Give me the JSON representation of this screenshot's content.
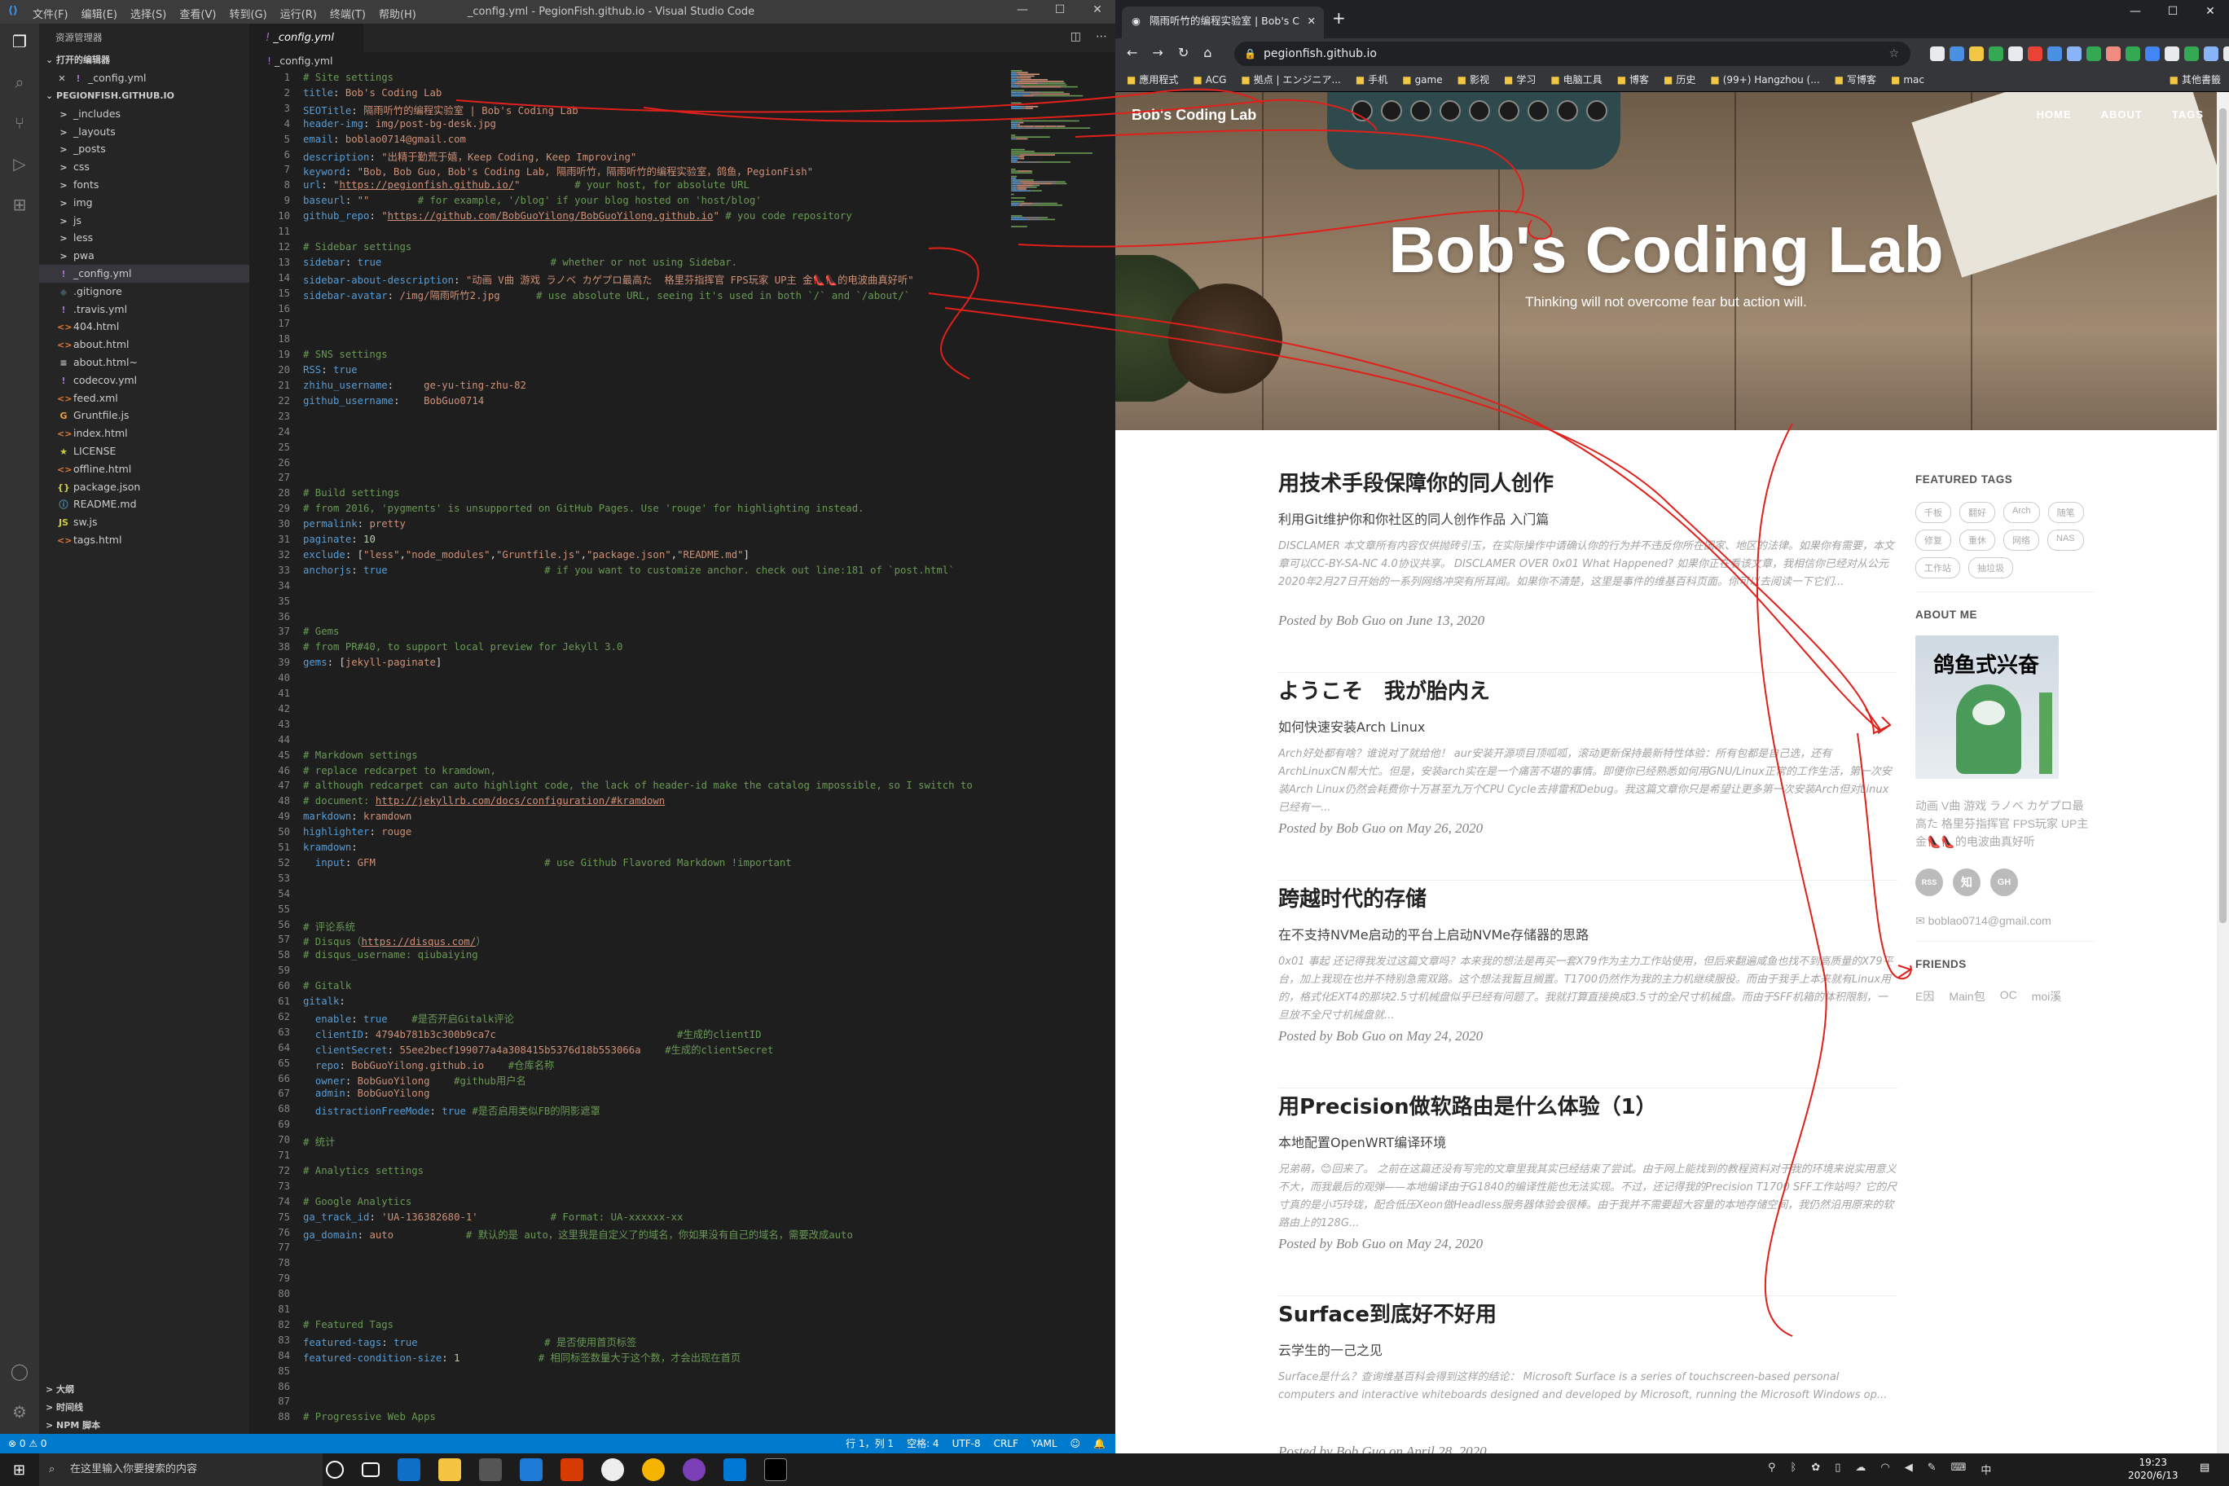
{
  "vscode": {
    "window_title": "_config.yml - PegionFish.github.io - Visual Studio Code",
    "menu": [
      "文件(F)",
      "编辑(E)",
      "选择(S)",
      "查看(V)",
      "转到(G)",
      "运行(R)",
      "终端(T)",
      "帮助(H)"
    ],
    "explorer_title": "资源管理器",
    "open_editors_label": "打开的编辑器",
    "open_editor_file": "_config.yml",
    "folder_label": "PEGIONFISH.GITHUB.IO",
    "files": [
      {
        "name": "_includes",
        "icon": ">",
        "color": "#cccccc"
      },
      {
        "name": "_layouts",
        "icon": ">",
        "color": "#cccccc"
      },
      {
        "name": "_posts",
        "icon": ">",
        "color": "#cccccc"
      },
      {
        "name": "css",
        "icon": ">",
        "color": "#cccccc"
      },
      {
        "name": "fonts",
        "icon": ">",
        "color": "#cccccc"
      },
      {
        "name": "img",
        "icon": ">",
        "color": "#cccccc"
      },
      {
        "name": "js",
        "icon": ">",
        "color": "#cccccc"
      },
      {
        "name": "less",
        "icon": ">",
        "color": "#cccccc"
      },
      {
        "name": "pwa",
        "icon": ">",
        "color": "#cccccc"
      },
      {
        "name": "_config.yml",
        "icon": "!",
        "color": "#a074c4",
        "selected": true
      },
      {
        "name": ".gitignore",
        "icon": "◆",
        "color": "#41535b"
      },
      {
        "name": ".travis.yml",
        "icon": "!",
        "color": "#a074c4"
      },
      {
        "name": "404.html",
        "icon": "<>",
        "color": "#e37933"
      },
      {
        "name": "about.html",
        "icon": "<>",
        "color": "#e37933"
      },
      {
        "name": "about.html~",
        "icon": "≡",
        "color": "#cccccc"
      },
      {
        "name": "codecov.yml",
        "icon": "!",
        "color": "#a074c4"
      },
      {
        "name": "feed.xml",
        "icon": "<>",
        "color": "#e37933"
      },
      {
        "name": "Gruntfile.js",
        "icon": "G",
        "color": "#e8a23c"
      },
      {
        "name": "index.html",
        "icon": "<>",
        "color": "#e37933"
      },
      {
        "name": "LICENSE",
        "icon": "★",
        "color": "#cbcb41"
      },
      {
        "name": "offline.html",
        "icon": "<>",
        "color": "#e37933"
      },
      {
        "name": "package.json",
        "icon": "{}",
        "color": "#cbcb41"
      },
      {
        "name": "README.md",
        "icon": "ⓘ",
        "color": "#519aba"
      },
      {
        "name": "sw.js",
        "icon": "JS",
        "color": "#cbcb41"
      },
      {
        "name": "tags.html",
        "icon": "<>",
        "color": "#e37933"
      }
    ],
    "bottom_sections": [
      "大纲",
      "时间线",
      "NPM 脚本"
    ],
    "tab_label": "_config.yml",
    "breadcrumb": "_config.yml",
    "code_lines": [
      [
        [
          "c",
          "# Site settings"
        ]
      ],
      [
        [
          "k",
          "title"
        ],
        [
          "p",
          ": "
        ],
        [
          "s",
          "Bob's Coding Lab"
        ]
      ],
      [
        [
          "k",
          "SEOTitle"
        ],
        [
          "p",
          ": "
        ],
        [
          "s",
          "隔雨听竹的编程实验室 | Bob's Coding Lab"
        ]
      ],
      [
        [
          "k",
          "header-img"
        ],
        [
          "p",
          ": "
        ],
        [
          "s",
          "img/post-bg-desk.jpg"
        ]
      ],
      [
        [
          "k",
          "email"
        ],
        [
          "p",
          ": "
        ],
        [
          "s",
          "boblao0714@gmail.com"
        ]
      ],
      [
        [
          "k",
          "description"
        ],
        [
          "p",
          ": "
        ],
        [
          "s",
          "\"出精于勤荒于嬉，Keep Coding, Keep Improving\""
        ]
      ],
      [
        [
          "k",
          "keyword"
        ],
        [
          "p",
          ": "
        ],
        [
          "s",
          "\"Bob, Bob Guo, Bob's Coding Lab, 隔雨听竹，隔雨听竹的编程实验室，鸽鱼，PegionFish\""
        ]
      ],
      [
        [
          "k",
          "url"
        ],
        [
          "p",
          ": "
        ],
        [
          "s",
          "\""
        ],
        [
          "l",
          "https://pegionfish.github.io/"
        ],
        [
          "s",
          "\""
        ],
        [
          "p",
          "         "
        ],
        [
          "c",
          "# your host, for absolute URL"
        ]
      ],
      [
        [
          "k",
          "baseurl"
        ],
        [
          "p",
          ": "
        ],
        [
          "s",
          "\"\""
        ],
        [
          "p",
          "        "
        ],
        [
          "c",
          "# for example, '/blog' if your blog hosted on 'host/blog'"
        ]
      ],
      [
        [
          "k",
          "github_repo"
        ],
        [
          "p",
          ": "
        ],
        [
          "s",
          "\""
        ],
        [
          "l",
          "https://github.com/BobGuoYilong/BobGuoYilong.github.io"
        ],
        [
          "s",
          "\""
        ],
        [
          "p",
          " "
        ],
        [
          "c",
          "# you code repository"
        ]
      ],
      [],
      [
        [
          "c",
          "# Sidebar settings"
        ]
      ],
      [
        [
          "k",
          "sidebar"
        ],
        [
          "p",
          ": "
        ],
        [
          "k",
          "true"
        ],
        [
          "p",
          "                            "
        ],
        [
          "c",
          "# whether or not using Sidebar."
        ]
      ],
      [
        [
          "k",
          "sidebar-about-description"
        ],
        [
          "p",
          ": "
        ],
        [
          "s",
          "\"动画 V曲 游戏 ラノベ カゲプロ最高た  格里芬指挥官 FPS玩家 UP主 金👠👠的电波曲真好听\""
        ]
      ],
      [
        [
          "k",
          "sidebar-avatar"
        ],
        [
          "p",
          ": "
        ],
        [
          "s",
          "/img/隔雨听竹2.jpg"
        ],
        [
          "p",
          "      "
        ],
        [
          "c",
          "# use absolute URL, seeing it's used in both `/` and `/about/`"
        ]
      ],
      [],
      [],
      [],
      [
        [
          "c",
          "# SNS settings"
        ]
      ],
      [
        [
          "k",
          "RSS"
        ],
        [
          "p",
          ": "
        ],
        [
          "k",
          "true"
        ]
      ],
      [
        [
          "k",
          "zhihu_username"
        ],
        [
          "p",
          ":     "
        ],
        [
          "s",
          "ge-yu-ting-zhu-82"
        ]
      ],
      [
        [
          "k",
          "github_username"
        ],
        [
          "p",
          ":    "
        ],
        [
          "s",
          "BobGuo0714"
        ]
      ],
      [],
      [],
      [],
      [],
      [],
      [
        [
          "c",
          "# Build settings"
        ]
      ],
      [
        [
          "c",
          "# from 2016, 'pygments' is unsupported on GitHub Pages. Use 'rouge' for highlighting instead."
        ]
      ],
      [
        [
          "k",
          "permalink"
        ],
        [
          "p",
          ": "
        ],
        [
          "s",
          "pretty"
        ]
      ],
      [
        [
          "k",
          "paginate"
        ],
        [
          "p",
          ": "
        ],
        [
          "n",
          "10"
        ]
      ],
      [
        [
          "k",
          "exclude"
        ],
        [
          "p",
          ": ["
        ],
        [
          "s",
          "\"less\""
        ],
        [
          "p",
          ","
        ],
        [
          "s",
          "\"node_modules\""
        ],
        [
          "p",
          ","
        ],
        [
          "s",
          "\"Gruntfile.js\""
        ],
        [
          "p",
          ","
        ],
        [
          "s",
          "\"package.json\""
        ],
        [
          "p",
          ","
        ],
        [
          "s",
          "\"README.md\""
        ],
        [
          "p",
          "]"
        ]
      ],
      [
        [
          "k",
          "anchorjs"
        ],
        [
          "p",
          ": "
        ],
        [
          "k",
          "true"
        ],
        [
          "p",
          "                          "
        ],
        [
          "c",
          "# if you want to customize anchor. check out line:181 of `post.html`"
        ]
      ],
      [],
      [],
      [],
      [
        [
          "c",
          "# Gems"
        ]
      ],
      [
        [
          "c",
          "# from PR#40, to support local preview for Jekyll 3.0"
        ]
      ],
      [
        [
          "k",
          "gems"
        ],
        [
          "p",
          ": ["
        ],
        [
          "s",
          "jekyll-paginate"
        ],
        [
          "p",
          "]"
        ]
      ],
      [],
      [],
      [],
      [],
      [],
      [
        [
          "c",
          "# Markdown settings"
        ]
      ],
      [
        [
          "c",
          "# replace redcarpet to kramdown,"
        ]
      ],
      [
        [
          "c",
          "# although redcarpet can auto highlight code, the lack of header-id make the catalog impossible, so I switch to"
        ]
      ],
      [
        [
          "c",
          "# document: "
        ],
        [
          "l",
          "http://jekyllrb.com/docs/configuration/#kramdown"
        ]
      ],
      [
        [
          "k",
          "markdown"
        ],
        [
          "p",
          ": "
        ],
        [
          "s",
          "kramdown"
        ]
      ],
      [
        [
          "k",
          "highlighter"
        ],
        [
          "p",
          ": "
        ],
        [
          "s",
          "rouge"
        ]
      ],
      [
        [
          "k",
          "kramdown"
        ],
        [
          "p",
          ":"
        ]
      ],
      [
        [
          "p",
          "  "
        ],
        [
          "k",
          "input"
        ],
        [
          "p",
          ": "
        ],
        [
          "s",
          "GFM"
        ],
        [
          "p",
          "                            "
        ],
        [
          "c",
          "# use Github Flavored Markdown !important"
        ]
      ],
      [],
      [],
      [],
      [
        [
          "c",
          "# 评论系统"
        ]
      ],
      [
        [
          "c",
          "# Disqus（"
        ],
        [
          "l",
          "https://disqus.com/"
        ],
        [
          "c",
          "）"
        ]
      ],
      [
        [
          "c",
          "# disqus_username: qiubaiying"
        ]
      ],
      [],
      [
        [
          "c",
          "# Gitalk"
        ]
      ],
      [
        [
          "k",
          "gitalk"
        ],
        [
          "p",
          ":"
        ]
      ],
      [
        [
          "p",
          "  "
        ],
        [
          "k",
          "enable"
        ],
        [
          "p",
          ": "
        ],
        [
          "k",
          "true"
        ],
        [
          "p",
          "    "
        ],
        [
          "c",
          "#是否开启Gitalk评论"
        ]
      ],
      [
        [
          "p",
          "  "
        ],
        [
          "k",
          "clientID"
        ],
        [
          "p",
          ": "
        ],
        [
          "s",
          "4794b781b3c300b9ca7c"
        ],
        [
          "p",
          "                              "
        ],
        [
          "c",
          "#生成的clientID"
        ]
      ],
      [
        [
          "p",
          "  "
        ],
        [
          "k",
          "clientSecret"
        ],
        [
          "p",
          ": "
        ],
        [
          "s",
          "55ee2becf199077a4a308415b5376d18b553066a"
        ],
        [
          "p",
          "    "
        ],
        [
          "c",
          "#生成的clientSecret"
        ]
      ],
      [
        [
          "p",
          "  "
        ],
        [
          "k",
          "repo"
        ],
        [
          "p",
          ": "
        ],
        [
          "s",
          "BobGuoYilong.github.io"
        ],
        [
          "p",
          "    "
        ],
        [
          "c",
          "#仓库名称"
        ]
      ],
      [
        [
          "p",
          "  "
        ],
        [
          "k",
          "owner"
        ],
        [
          "p",
          ": "
        ],
        [
          "s",
          "BobGuoYilong"
        ],
        [
          "p",
          "    "
        ],
        [
          "c",
          "#github用户名"
        ]
      ],
      [
        [
          "p",
          "  "
        ],
        [
          "k",
          "admin"
        ],
        [
          "p",
          ": "
        ],
        [
          "s",
          "BobGuoYilong"
        ]
      ],
      [
        [
          "p",
          "  "
        ],
        [
          "k",
          "distractionFreeMode"
        ],
        [
          "p",
          ": "
        ],
        [
          "k",
          "true"
        ],
        [
          "p",
          " "
        ],
        [
          "c",
          "#是否启用类似FB的阴影遮罩"
        ]
      ],
      [],
      [
        [
          "c",
          "# 统计"
        ]
      ],
      [],
      [
        [
          "c",
          "# Analytics settings"
        ]
      ],
      [],
      [
        [
          "c",
          "# Google Analytics"
        ]
      ],
      [
        [
          "k",
          "ga_track_id"
        ],
        [
          "p",
          ": "
        ],
        [
          "s",
          "'UA-136382680-1'"
        ],
        [
          "p",
          "            "
        ],
        [
          "c",
          "# Format: UA-xxxxxx-xx"
        ]
      ],
      [
        [
          "k",
          "ga_domain"
        ],
        [
          "p",
          ": "
        ],
        [
          "s",
          "auto"
        ],
        [
          "p",
          "            "
        ],
        [
          "c",
          "# 默认的是 auto，这里我是自定义了的域名，你如果没有自己的域名，需要改成auto"
        ]
      ],
      [],
      [],
      [],
      [],
      [],
      [
        [
          "c",
          "# Featured Tags"
        ]
      ],
      [
        [
          "k",
          "featured-tags"
        ],
        [
          "p",
          ": "
        ],
        [
          "k",
          "true"
        ],
        [
          "p",
          "                     "
        ],
        [
          "c",
          "# 是否使用首页标签"
        ]
      ],
      [
        [
          "k",
          "featured-condition-size"
        ],
        [
          "p",
          ": "
        ],
        [
          "n",
          "1"
        ],
        [
          "p",
          "             "
        ],
        [
          "c",
          "# 相同标签数量大于这个数，才会出现在首页"
        ]
      ],
      [],
      [],
      [],
      [
        [
          "c",
          "# Progressive Web Apps"
        ]
      ]
    ],
    "status": {
      "left": "⊗ 0 ⚠ 0",
      "position": "行 1，列 1",
      "spaces": "空格: 4",
      "encoding": "UTF-8",
      "eol": "CRLF",
      "language": "YAML"
    }
  },
  "chrome": {
    "tab_title": "隔雨听竹的编程实验室 | Bob's C",
    "url": "pegionfish.github.io",
    "bookmarks": [
      "應用程式",
      "ACG",
      "拠点 | エンジニア...",
      "手机",
      "game",
      "影视",
      "学习",
      "电脑工具",
      "博客",
      "历史",
      "(99+) Hangzhou (...",
      "写博客",
      "mac"
    ],
    "bookmark_other": "其他書籤",
    "site": {
      "brand": "Bob's Coding Lab",
      "nav": [
        "HOME",
        "ABOUT",
        "TAGS"
      ],
      "hero_title": "Bob's Coding Lab",
      "hero_subtitle": "Thinking will not overcome fear but action will.",
      "posts": [
        {
          "title": "用技术手段保障你的同人创作",
          "subtitle": "利用Git维护你和你社区的同人创作作品 入门篇",
          "excerpt": "DISCLAMER 本文章所有内容仅供抛砖引玉，在实际操作中请确认你的行为并不违反你所在国家、地区的法律。如果你有需要，本文章可以CC-BY-SA-NC 4.0协议共享。 DISCLAMER OVER 0x01 What Happened? 如果你正在看该文章，我相信你已经对从公元2020年2月27日开始的一系列网络冲突有所耳闻。如果你不清楚，这里是事件的维基百科页面。你可以去阅读一下它们...",
          "meta": "Posted by Bob Guo on June 13, 2020"
        },
        {
          "title": "ようこそ　我が胎内え",
          "subtitle": "如何快速安装Arch Linux",
          "excerpt": "Arch好处都有啥？谁说对了就给他！ aur安装开源项目顶呱呱，滚动更新保持最新特性体验：所有包都是自己选，还有ArchLinuxCN帮大忙。但是，安装arch实在是一个痛苦不堪的事情。即便你已经熟悉如何用GNU/Linux正常的工作生活，第一次安装Arch Linux仍然会耗费你十万甚至九万个CPU Cycle去排雷和Debug。我这篇文章你只是希望让更多第一次安装Arch但对Linux已经有一...",
          "meta": "Posted by Bob Guo on May 26, 2020"
        },
        {
          "title": "跨越时代的存储",
          "subtitle": "在不支持NVMe启动的平台上启动NVMe存储器的思路",
          "excerpt": "0x01 事起 还记得我发过这篇文章吗？本来我的想法是再买一套X79作为主力工作站使用，但后来翻遍咸鱼也找不到高质量的X79平台，加上我现在也并不特别急需双路。这个想法我暂且搁置。T1700仍然作为我的主力机继续服役。而由于我手上本来就有Linux用的，格式化EXT4的那块2.5寸机械盘似乎已经有问题了。我就打算直接换成3.5寸的全尺寸机械盘。而由于SFF机箱的体积限制，一旦放不全尺寸机械盘就...",
          "meta": "Posted by Bob Guo on May 24, 2020"
        },
        {
          "title": "用Precision做软路由是什么体验（1）",
          "subtitle": "本地配置OpenWRT编译环境",
          "excerpt": "兄弟萌，😊回来了。 之前在这篇还没有写完的文章里我其实已经结束了尝试。由于网上能找到的教程资料对于我的环境来说实用意义不大，而我最后的观弹——本地编译由于G1840的编译性能也无法实现。不过，还记得我的Precision T1700 SFF工作站吗？它的尺寸真的是小巧玲珑，配合低压Xeon做Headless服务器体验会很棒。由于我并不需要超大容量的本地存储空间，我仍然沿用原来的软路由上的128G...",
          "meta": "Posted by Bob Guo on May 24, 2020"
        },
        {
          "title": "Surface到底好不好用",
          "subtitle": "云学生的一己之见",
          "excerpt": "Surface是什么？查询维基百科会得到这样的结论： Microsoft Surface is a series of touchscreen-based personal computers and interactive whiteboards designed and developed by Microsoft, running the Microsoft Windows op...",
          "meta": "Posted by Bob Guo on April 28, 2020"
        }
      ],
      "featured_tags_label": "FEATURED TAGS",
      "tags": [
        "千板",
        "翻好",
        "Arch",
        "随笔",
        "修复",
        "重休",
        "网络",
        "NAS",
        "工作站",
        "抽垃圾"
      ],
      "about_label": "ABOUT ME",
      "avatar_caption": "鸽鱼式兴奋",
      "about_text": "动画 V曲 游戏 ラノベ カゲプロ最高た  格里芬指挥官 FPS玩家 UP主 金👠👠的电波曲真好听",
      "social": [
        "RSS",
        "知",
        "GH"
      ],
      "email": "boblao0714@gmail.com",
      "friends_label": "FRIENDS",
      "friends": [
        "E因",
        "Main包",
        "OC",
        "moi溪"
      ]
    }
  },
  "taskbar": {
    "search_placeholder": "在这里输入你要搜索的内容",
    "time": "19:23",
    "date": "2020/6/13",
    "ime": "中"
  }
}
